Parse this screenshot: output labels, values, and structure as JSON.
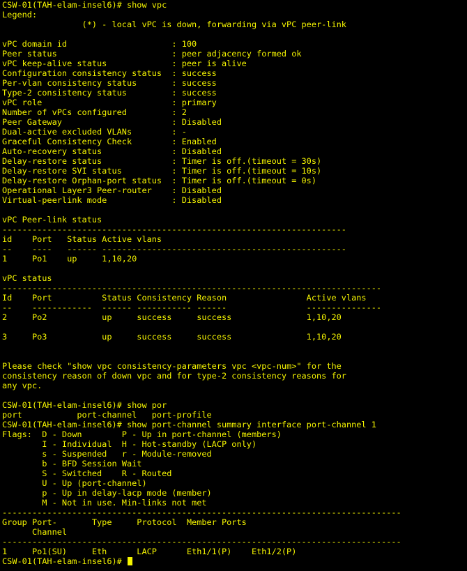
{
  "terminal": {
    "text_color": "#f5f500",
    "background_color": "#000000",
    "lines": [
      "CSW-01(TAH-elam-insel6)# show vpc",
      "Legend:",
      "                (*) - local vPC is down, forwarding via vPC peer-link",
      "",
      "vPC domain id                     : 100",
      "Peer status                       : peer adjacency formed ok",
      "vPC keep-alive status             : peer is alive",
      "Configuration consistency status  : success",
      "Per-vlan consistency status       : success",
      "Type-2 consistency status         : success",
      "vPC role                          : primary",
      "Number of vPCs configured         : 2",
      "Peer Gateway                      : Disabled",
      "Dual-active excluded VLANs        : -",
      "Graceful Consistency Check        : Enabled",
      "Auto-recovery status              : Disabled",
      "Delay-restore status              : Timer is off.(timeout = 30s)",
      "Delay-restore SVI status          : Timer is off.(timeout = 10s)",
      "Delay-restore Orphan-port status  : Timer is off.(timeout = 0s)",
      "Operational Layer3 Peer-router    : Disabled",
      "Virtual-peerlink mode             : Disabled",
      "",
      "vPC Peer-link status",
      "---------------------------------------------------------------------",
      "id    Port   Status Active vlans",
      "--    ----   ------ -------------------------------------------------",
      "1     Po1    up     1,10,20",
      "",
      "vPC status",
      "----------------------------------------------------------------------------",
      "Id    Port          Status Consistency Reason                Active vlans",
      "--    ------------  ------ ----------- ------                ---------------",
      "2     Po2           up     success     success               1,10,20",
      "",
      "3     Po3           up     success     success               1,10,20",
      "",
      "",
      "Please check \"show vpc consistency-parameters vpc <vpc-num>\" for the",
      "consistency reason of down vpc and for type-2 consistency reasons for",
      "any vpc.",
      "",
      "CSW-01(TAH-elam-insel6)# show por",
      "port           port-channel   port-profile",
      "CSW-01(TAH-elam-insel6)# show port-channel summary interface port-channel 1",
      "Flags:  D - Down        P - Up in port-channel (members)",
      "        I - Individual  H - Hot-standby (LACP only)",
      "        s - Suspended   r - Module-removed",
      "        b - BFD Session Wait",
      "        S - Switched    R - Routed",
      "        U - Up (port-channel)",
      "        p - Up in delay-lacp mode (member)",
      "        M - Not in use. Min-links not met",
      "--------------------------------------------------------------------------------",
      "Group Port-       Type     Protocol  Member Ports",
      "      Channel",
      "--------------------------------------------------------------------------------",
      "1     Po1(SU)     Eth      LACP      Eth1/1(P)    Eth1/2(P)"
    ],
    "prompt": "CSW-01(TAH-elam-insel6)# "
  }
}
